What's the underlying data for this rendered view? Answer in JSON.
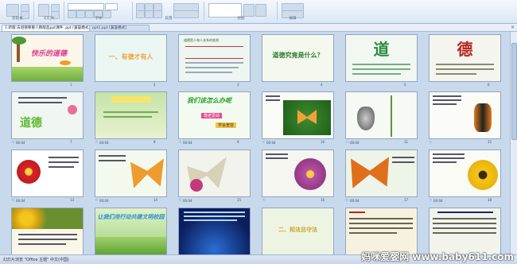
{
  "ribbon": {
    "groups": [
      "剪贴板",
      "幻灯片",
      "字体",
      "段落",
      "绘图",
      "编辑"
    ],
    "group_labels_short": [
      "粘贴",
      "新建",
      "B I U",
      "≡ ≡",
      "形状",
      "查找"
    ]
  },
  "doc_tabs": [
    {
      "label": "1.新版:去道德尊重人教版品ppt课件 .ppt [兼容模式]",
      "active": true
    },
    {
      "label": "ppt1.ppt [兼容模式]",
      "active": false
    }
  ],
  "slides": [
    {
      "num": "1",
      "time": "",
      "title": "快乐的道德",
      "kind": "cartoon"
    },
    {
      "num": "2",
      "time": "",
      "title": "一、有德才有人",
      "kind": "text"
    },
    {
      "num": "3",
      "time": "",
      "title": "道德是人和人关系的准则",
      "kind": "text"
    },
    {
      "num": "4",
      "time": "",
      "title": "道德究竟是什么？",
      "kind": "title"
    },
    {
      "num": "5",
      "time": "",
      "title": "道",
      "kind": "char"
    },
    {
      "num": "6",
      "time": "",
      "title": "德",
      "kind": "char"
    },
    {
      "num": "7",
      "time": "",
      "title": "道德",
      "kind": "char2"
    },
    {
      "num": "8",
      "time": "",
      "title": "",
      "kind": "photo"
    },
    {
      "num": "9",
      "time": "",
      "title": "我们该怎么办呢",
      "kind": "question"
    },
    {
      "num": "10",
      "time": "00:04",
      "title": "",
      "kind": "butterfly"
    },
    {
      "num": "11",
      "time": "00:04",
      "title": "",
      "kind": "cocoon"
    },
    {
      "num": "12",
      "time": "00:04",
      "title": "",
      "kind": "chrysalis"
    },
    {
      "num": "13",
      "time": "00:04",
      "title": "",
      "kind": "flower-text"
    },
    {
      "num": "14",
      "time": "00:04",
      "title": "",
      "kind": "butterfly2"
    },
    {
      "num": "15",
      "time": "",
      "title": "",
      "kind": "butterfly3"
    },
    {
      "num": "16",
      "time": "00:04",
      "title": "",
      "kind": "butterfly4"
    },
    {
      "num": "17",
      "time": "00:04",
      "title": "",
      "kind": "butterfly5"
    },
    {
      "num": "18",
      "time": "00:04",
      "title": "",
      "kind": "flower2"
    },
    {
      "num": "19",
      "time": "",
      "title": "",
      "kind": "flower3"
    },
    {
      "num": "20",
      "time": "",
      "title": "让我们用行动共建校园",
      "kind": "banner"
    },
    {
      "num": "21",
      "time": "",
      "title": "",
      "kind": "night"
    },
    {
      "num": "22",
      "time": "",
      "title": "二、知法且守法",
      "kind": "section"
    },
    {
      "num": "23",
      "time": "",
      "title": "",
      "kind": "doc"
    },
    {
      "num": "24",
      "time": "",
      "title": "",
      "kind": "doc2"
    }
  ],
  "slide_texts": {
    "s4": "道德究竟是什么？",
    "s5": "道",
    "s6": "德",
    "s7": "道德",
    "s9a": "我们该怎么办呢",
    "s9b": "尊老爱幼",
    "s9c": "学会宽容",
    "s20": "让我们用行动共建文明校园",
    "s22": "二、知法且守法"
  },
  "status": {
    "left": "幻灯片浏览  \"Office 主题\"  中文(中国)"
  },
  "watermark": "妈咪爱婴网 www.baby611.com"
}
